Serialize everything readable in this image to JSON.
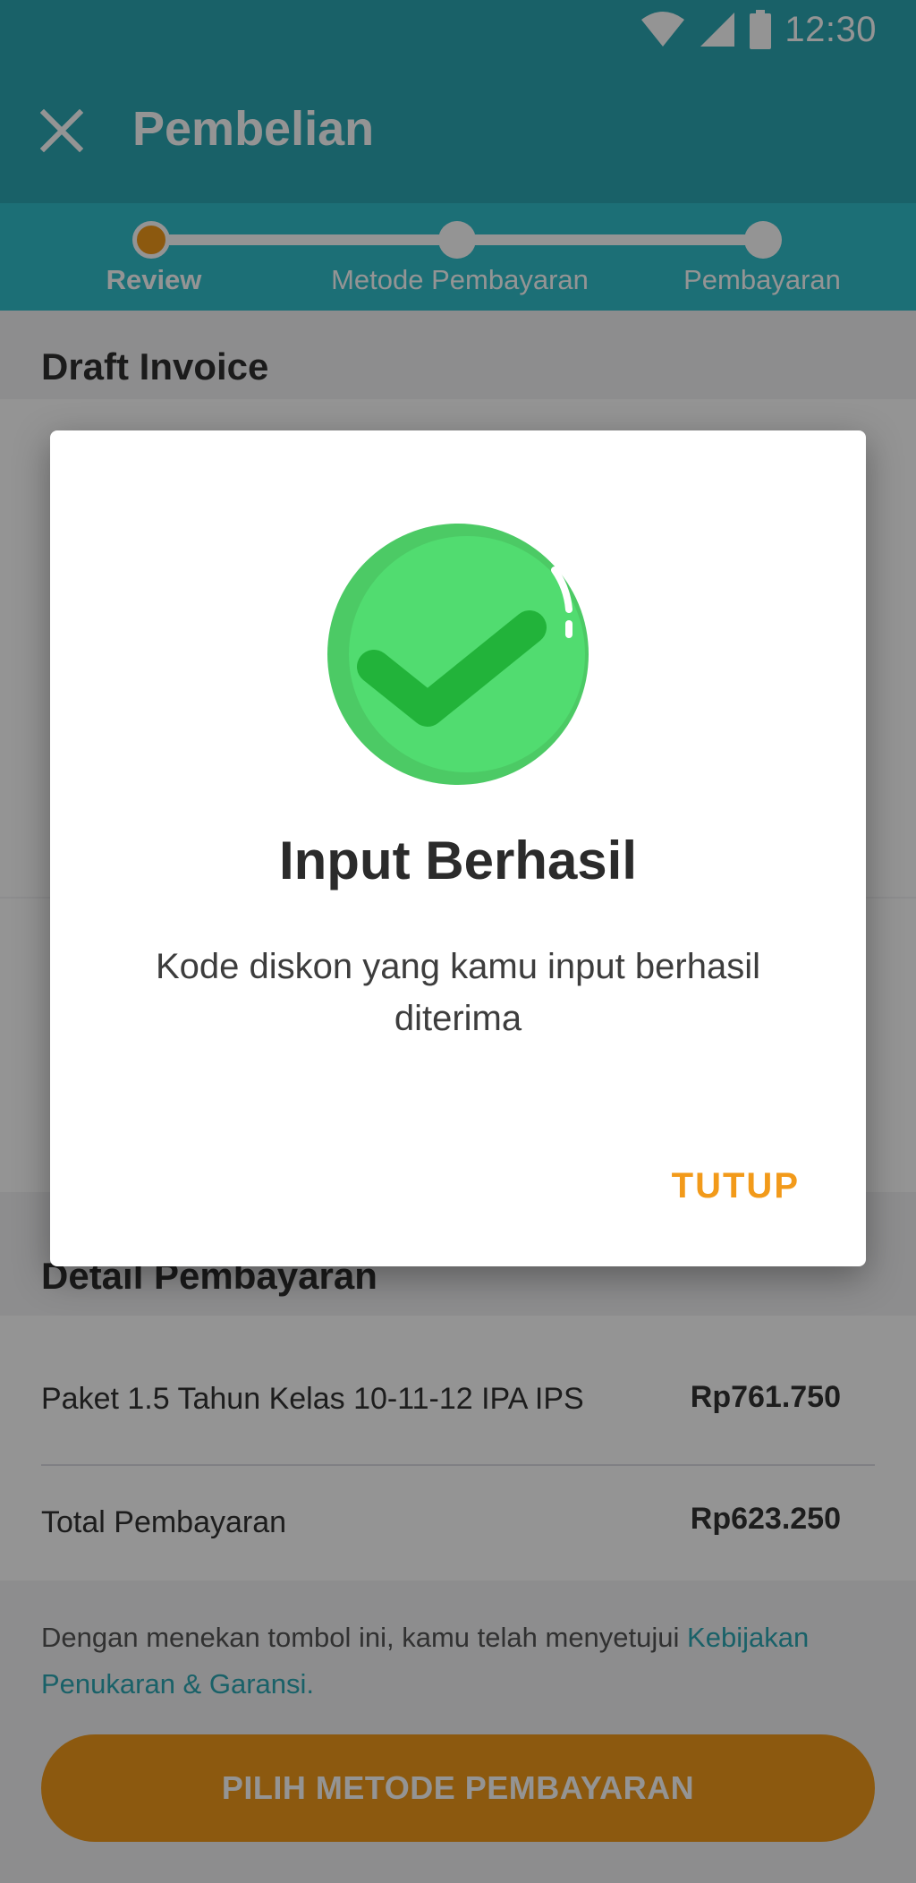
{
  "status_bar": {
    "time": "12:30",
    "icons": [
      "wifi-icon",
      "signal-icon",
      "battery-icon"
    ]
  },
  "app_bar": {
    "title": "Pembelian",
    "close_icon": "close-icon"
  },
  "stepper": {
    "steps": [
      {
        "label": "Review",
        "active": true
      },
      {
        "label": "Metode Pembayaran",
        "active": false
      },
      {
        "label": "Pembayaran",
        "active": false
      }
    ]
  },
  "draft_invoice": {
    "title": "Draft Invoice"
  },
  "payment_detail": {
    "title": "Detail Pembayaran",
    "rows": [
      {
        "label": "Paket 1.5 Tahun Kelas 10-11-12 IPA IPS",
        "value": "Rp761.750"
      },
      {
        "label": "Total Pembayaran",
        "value": "Rp623.250"
      }
    ]
  },
  "legal": {
    "text": "Dengan menekan tombol ini, kamu telah menyetujui ",
    "link": "Kebijakan Penukaran & Garansi."
  },
  "cta": {
    "label": "PILIH METODE PEMBAYARAN"
  },
  "dialog": {
    "icon": "check-circle-icon",
    "title": "Input Berhasil",
    "message": "Kode diskon yang kamu input berhasil diterima",
    "button": "TUTUP"
  },
  "colors": {
    "primary": "#2ba7b4",
    "accent": "#f29a1a",
    "success": "#51dc70",
    "success_dark": "#22b33a"
  }
}
